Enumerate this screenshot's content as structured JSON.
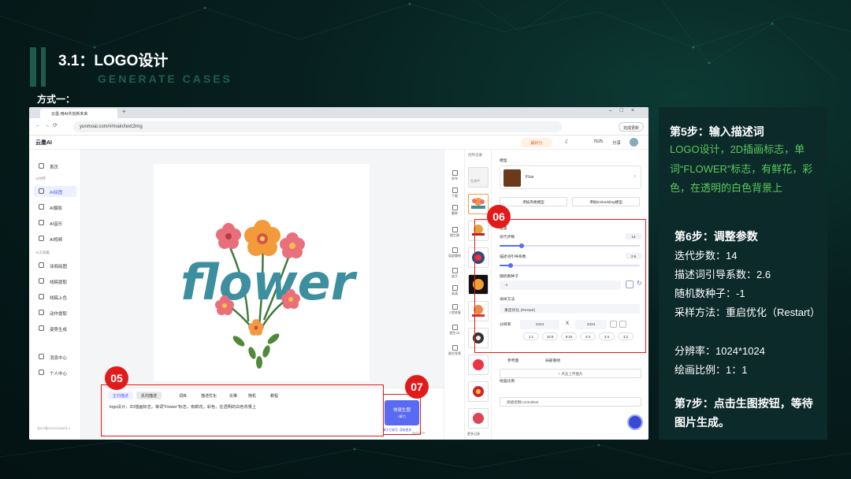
{
  "slide": {
    "title": "3.1：LOGO设计",
    "subtitle": "GENERATE CASES",
    "method": "方式一："
  },
  "browser": {
    "tab_title": "云墨-用AI共创新未来",
    "url": "yunmoai.com/#/main/text2img",
    "update_btn": "完成更新"
  },
  "app": {
    "logo": "云墨AI",
    "vip_label": "赢积分",
    "points": "7625",
    "share": "分享",
    "sidebar": {
      "home": "首页",
      "ai_create_head": "AI创作",
      "items": [
        "AI绘图",
        "AI摄影",
        "AI音乐",
        "AI视频"
      ],
      "tools_head": "AI工具箱",
      "tools": [
        "涂鸦绘图",
        "线稿提取",
        "线稿上色",
        "动作提取",
        "姿势生成"
      ],
      "bottom": [
        "消息中心",
        "个人中心"
      ],
      "footer": "浙ICP备2023028088号-2"
    },
    "image_text": "flower",
    "toolbar": [
      "发布",
      "下载",
      "删除",
      "图生图",
      "局部重绘",
      "放大",
      "高清",
      "人脸修复",
      "图生3D",
      "图生视频"
    ],
    "history_title": "创作记录",
    "history_status": "生成中",
    "history_more": "更多记录",
    "settings": {
      "model_head": "模型",
      "model_name": "Flux",
      "add_style_model": "添加风格模型",
      "add_embedding": "添加Embedding模型",
      "section": "设置",
      "steps_label": "迭代步数",
      "steps_value": "14",
      "guidance_label": "描述词引导系数",
      "guidance_value": "2.6",
      "seed_label": "随机数种子",
      "seed_value": "-1",
      "sampler_label": "采样方法",
      "sampler_value": "重启优化 (Restart)",
      "res_label": "分辨率",
      "res_w": "1024",
      "res_x": "X",
      "res_h": "1024",
      "ratio_label": "绘画比例",
      "ratios": [
        "1:1",
        "16:9",
        "9:16",
        "4:3",
        "3:4",
        "3:2"
      ],
      "ref_image": "参考图",
      "reference": "局部重绘",
      "upload": "+ 点击上传图片",
      "controlnet": "高级控制ControlNet"
    },
    "bottom_bar": {
      "tabs": [
        "正向描述",
        "反向描述",
        "词库",
        "描述优化",
        "反推",
        "随机",
        "教程"
      ],
      "prompt": "logo设计，2D插画标志，单词\"Flower\"标志，有鲜花，彩色，在透明的白色背景上",
      "count": "36/2000",
      "generate": "快速生图",
      "generate_sub": "0算力",
      "generate_note": "算力已耗尽, 获取更多"
    }
  },
  "markers": {
    "m05": "05",
    "m06": "06",
    "m07": "07"
  },
  "panel": {
    "step5_title": "第5步：输入描述词",
    "step5_text": "LOGO设计，2D插画标志，单词“FLOWER”标志，有鲜花，彩色，在透明的白色背景上",
    "step6_title": "第6步：调整参数",
    "step6_lines": [
      "迭代步数：14",
      "描述词引导系数：2.6",
      "随机数种子：-1",
      "采样方法：重启优化（Restart）",
      "分辨率：1024*1024",
      "绘画比例：1：1"
    ],
    "step7_title": "第7步：点击生图按钮，等待图片生成。"
  },
  "colors": {
    "accent": "#5b6af2",
    "marker": "#e11b1b",
    "step_green": "#58c95a"
  }
}
